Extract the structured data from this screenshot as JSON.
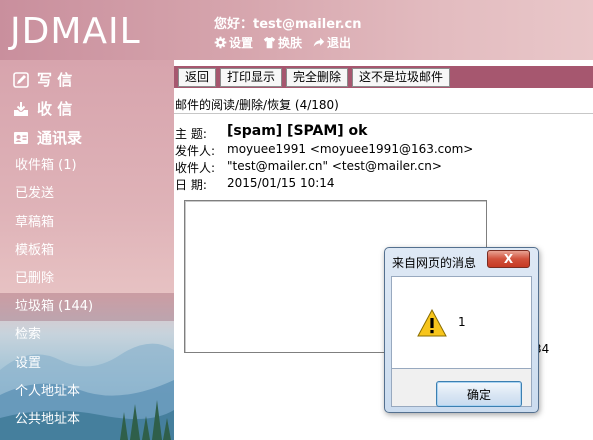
{
  "app": {
    "logo": "JDMAIL"
  },
  "header": {
    "greeting": "您好：test@mailer.cn",
    "links": [
      {
        "label": "设置",
        "icon": "gear-icon"
      },
      {
        "label": "换肤",
        "icon": "shirt-icon"
      },
      {
        "label": "退出",
        "icon": "logout-arrow-icon"
      }
    ]
  },
  "sidebar": {
    "main": [
      {
        "label": "写  信",
        "icon": "pencil-icon"
      },
      {
        "label": "收  信",
        "icon": "inbox-icon"
      },
      {
        "label": "通讯录",
        "icon": "contacts-icon"
      }
    ],
    "folders": [
      {
        "label": "收件箱 (1)"
      },
      {
        "label": "已发送"
      },
      {
        "label": "草稿箱"
      },
      {
        "label": "模板箱"
      },
      {
        "label": "已删除"
      },
      {
        "label": "垃圾箱 (144)",
        "active": true
      },
      {
        "label": "检索"
      },
      {
        "label": "设置"
      },
      {
        "label": "个人地址本"
      },
      {
        "label": "公共地址本"
      }
    ]
  },
  "toolbar": {
    "buttons": [
      {
        "label": "返回"
      },
      {
        "label": "打印显示"
      },
      {
        "label": "完全删除"
      },
      {
        "label": "这不是垃圾邮件"
      }
    ]
  },
  "subtitle": "邮件的阅读/删除/恢复 (4/180)",
  "email": {
    "subject_label": "主  题:",
    "subject": "[spam] [SPAM] ok",
    "from_label": "发件人:",
    "from": "moyuee1991 <moyuee1991@163.com>",
    "to_label": "收件人:",
    "to": "\"test@mailer.cn\" <test@mailer.cn>",
    "date_label": "日  期:",
    "date": "2015/01/15 10:14"
  },
  "stray_text": "34",
  "dialog": {
    "title": "来自网页的消息",
    "message": "1",
    "ok_label": "确定",
    "close_label": "X",
    "icon": "warning-icon"
  },
  "colors": {
    "toolbar_bar": "#a6576f",
    "header_pink": "#d6a5ad"
  }
}
